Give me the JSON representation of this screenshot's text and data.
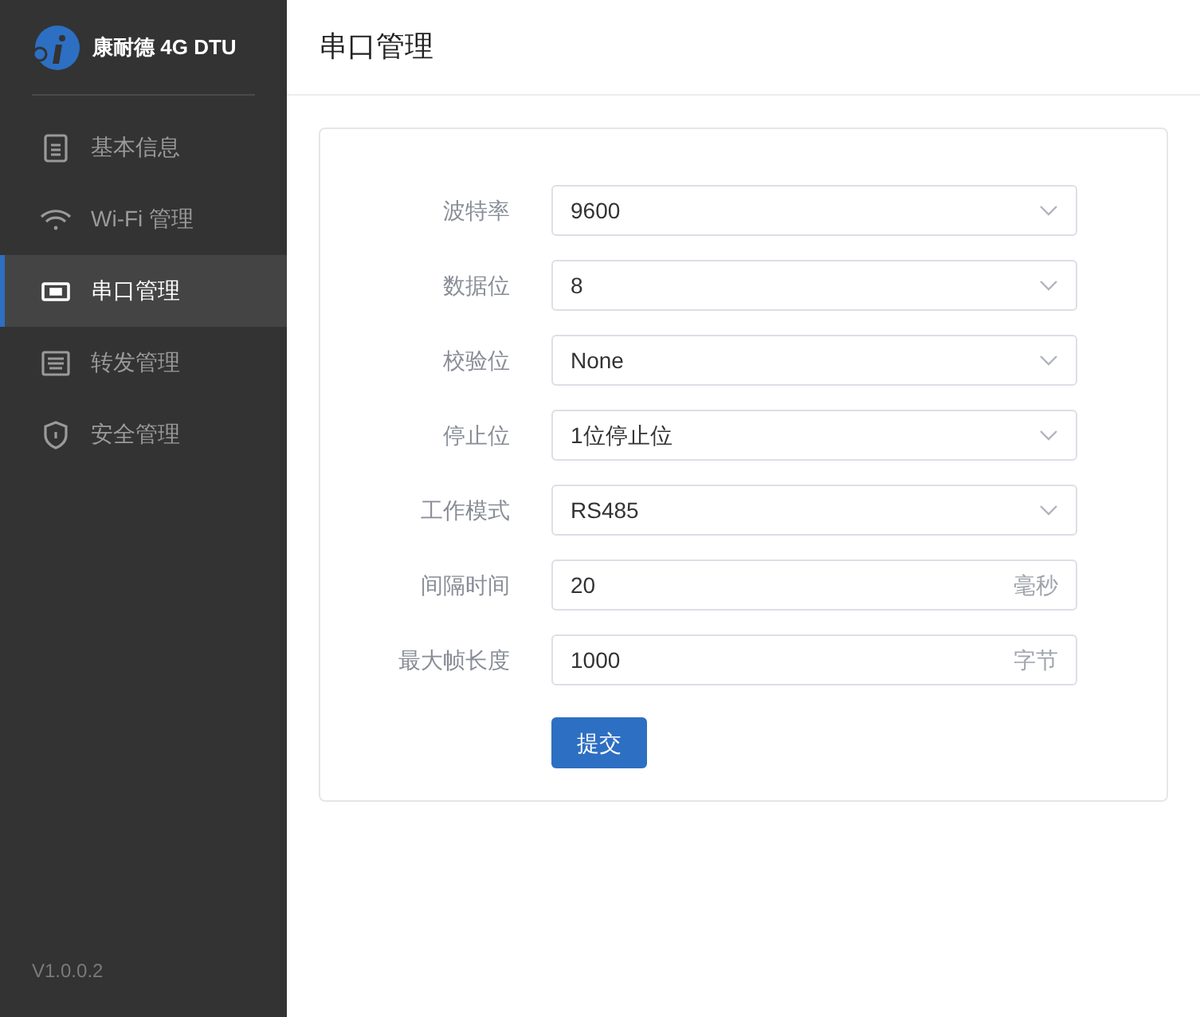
{
  "brand": {
    "name": "康耐德 4G DTU"
  },
  "nav": [
    {
      "label": "基本信息",
      "selected": false
    },
    {
      "label": "Wi-Fi 管理",
      "selected": false
    },
    {
      "label": "串口管理",
      "selected": true
    },
    {
      "label": "转发管理",
      "selected": false
    },
    {
      "label": "安全管理",
      "selected": false
    }
  ],
  "version": "V1.0.0.2",
  "page_title": "串口管理",
  "form": {
    "fields": [
      {
        "label": "波特率",
        "kind": "select",
        "value": "9600"
      },
      {
        "label": "数据位",
        "kind": "select",
        "value": "8"
      },
      {
        "label": "校验位",
        "kind": "select",
        "value": "None"
      },
      {
        "label": "停止位",
        "kind": "select",
        "value": "1位停止位"
      },
      {
        "label": "工作模式",
        "kind": "select",
        "value": "RS485"
      },
      {
        "label": "间隔时间",
        "kind": "input",
        "value": "20",
        "suffix": "毫秒"
      },
      {
        "label": "最大帧长度",
        "kind": "input",
        "value": "1000",
        "suffix": "字节"
      }
    ],
    "submit": "提交"
  }
}
